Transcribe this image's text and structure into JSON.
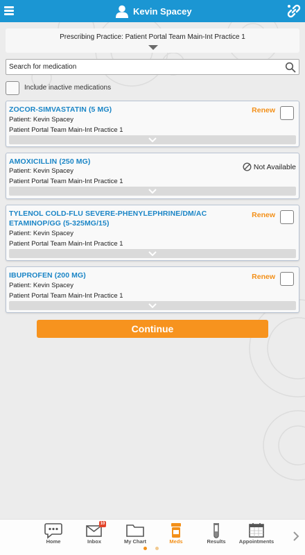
{
  "header": {
    "user_name": "Kevin Spacey",
    "accent_color": "#1b96d3",
    "icons": [
      "menu-icon",
      "user-icon",
      "link-icon"
    ]
  },
  "practice": {
    "label": "Prescribing Practice: Patient Portal Team Main-Int Practice 1"
  },
  "search": {
    "placeholder": "Search for medication",
    "value": ""
  },
  "include_inactive": {
    "label": "Include inactive medications",
    "checked": false
  },
  "medications": [
    {
      "name": "ZOCOR-SIMVASTATIN (5 MG)",
      "patient": "Patient: Kevin Spacey",
      "practice": "Patient Portal Team Main-Int Practice 1",
      "action": "Renew",
      "checked": false
    },
    {
      "name": "AMOXICILLIN (250 MG)",
      "patient": "Patient: Kevin Spacey",
      "practice": "Patient Portal Team Main-Int Practice 1",
      "status": "Not Available"
    },
    {
      "name": "TYLENOL COLD-FLU SEVERE-PHENYLEPHRINE/DM/AC ETAMINOP/GG (5-325MG/15)",
      "name_line1": "TYLENOL COLD-FLU SEVERE-PHENYLEPHRINE/DM/AC",
      "name_line2": "ETAMINOP/GG (5-325MG/15)",
      "patient": "Patient: Kevin Spacey",
      "practice": "Patient Portal Team Main-Int Practice 1",
      "action": "Renew",
      "checked": false
    },
    {
      "name": "IBUPROFEN (200 MG)",
      "patient": "Patient: Kevin Spacey",
      "practice": "Patient Portal Team Main-Int Practice 1",
      "action": "Renew",
      "checked": false
    }
  ],
  "continue_label": "Continue",
  "colors": {
    "med_name": "#1a85c6",
    "renew": "#f39019",
    "continue_button": "#f7931e"
  },
  "nav": {
    "items": [
      {
        "label": "Home",
        "icon": "chat-bubble-icon"
      },
      {
        "label": "Inbox",
        "icon": "envelope-icon",
        "badge": "10"
      },
      {
        "label": "My Chart",
        "icon": "folder-icon"
      },
      {
        "label": "Meds",
        "icon": "pill-bottle-icon",
        "active": true
      },
      {
        "label": "Results",
        "icon": "test-tube-icon"
      },
      {
        "label": "Appointments",
        "icon": "calendar-icon"
      }
    ],
    "more_icon": "chevron-right-icon",
    "page_dots": {
      "count": 2,
      "active": 1
    }
  }
}
